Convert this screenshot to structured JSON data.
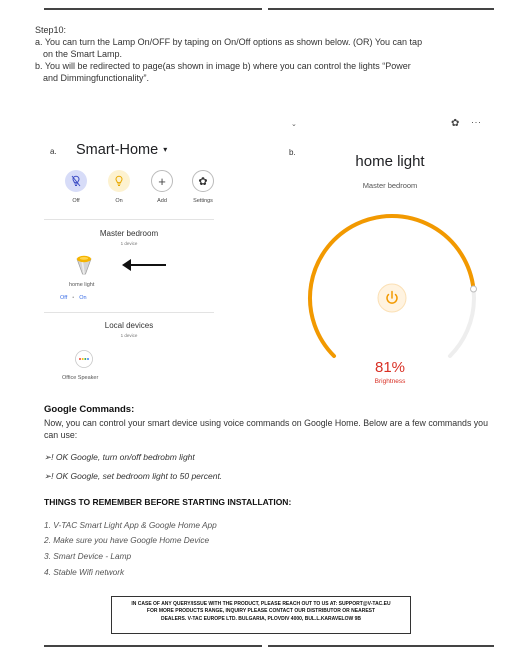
{
  "step": {
    "title": "Step10:",
    "line_a1": "a. You can turn the Lamp On/OFF  by taping on On/Off options as shown below. (OR) You can tap",
    "line_a2": "on the Smart Lamp.",
    "line_b1": "b. You will be redirected to page(as shown in image b) where you can control the lights “Power",
    "line_b2": "and Dimmingfunctionality”."
  },
  "phone_a": {
    "letter": "a.",
    "title": "Smart-Home",
    "caret": "▾",
    "actions": [
      {
        "label": "Off",
        "icon": "lightbulb-off-icon"
      },
      {
        "label": "On",
        "icon": "lightbulb-on-icon"
      },
      {
        "label": "Add",
        "icon": "plus-icon"
      },
      {
        "label": "Settings",
        "icon": "gear-icon"
      }
    ],
    "room": {
      "title": "Master bedroom",
      "count": "1 device"
    },
    "device": {
      "label": "home light",
      "off": "Off",
      "sep": "•",
      "on": "On"
    },
    "local": {
      "title": "Local devices",
      "count": "1 device"
    },
    "speaker": {
      "label": "Office Speaker"
    }
  },
  "phone_b": {
    "letter": "b.",
    "title": "home light",
    "subtitle": "Master bedroom",
    "brightness_value": "81%",
    "brightness_label": "Brightness",
    "brightness_level": 0.81,
    "accent_color": "#f29900"
  },
  "google": {
    "heading": "Google Commands:",
    "body": "Now, you can control your smart device using voice commands on Google Home. Below are a few commands you can use:",
    "cmd1": "➢! OK Google, turn on/off bedrobm light",
    "cmd2": "➢! OK Google, set bedroom light to 50 percent."
  },
  "things": {
    "heading": "THINGS TO REMEMBER BEFORE STARTING INSTALLATION:",
    "items": [
      "1. V-TAC Smart Light App & Google Home App",
      "2. Make sure you have Google Home Device",
      "3. Smart Device - Lamp",
      "4. Stable Wifi network"
    ]
  },
  "notice": {
    "line1": "IN CASE OF ANY QUERY/ISSUE WITH THE PRODUCT, PLEASE REACH OUT TO US AT: SUPPORT@V-TAC.EU",
    "line2": "FOR MORE PRODUCTS RANGE, INQUIRY PLEASE CONTACT OUR DISTRIBUTOR OR NEAREST",
    "line3": "DEALERS. V-TAC EUROPE LTD. BULGARIA, PLOVDIV 4000, BUL.L.KARAVELOW 9B"
  }
}
